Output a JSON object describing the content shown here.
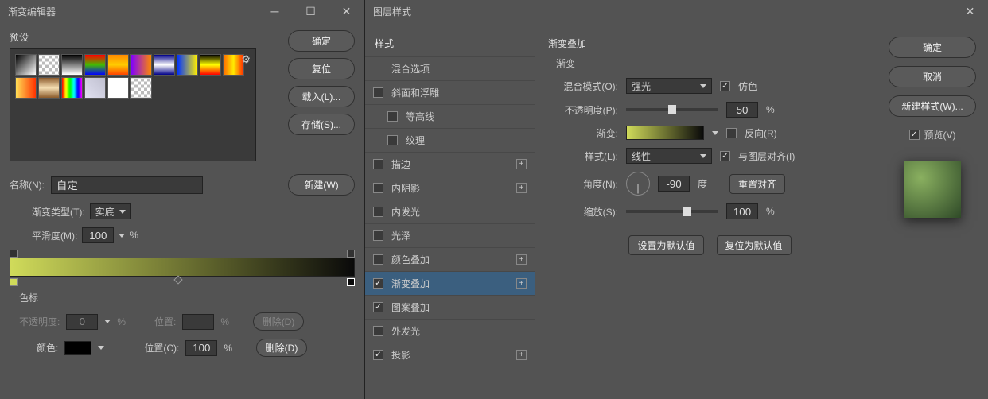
{
  "left": {
    "title": "渐变编辑器",
    "presets_label": "预设",
    "buttons": {
      "ok": "确定",
      "reset": "复位",
      "load": "载入(L)...",
      "save": "存储(S)...",
      "new": "新建(W)"
    },
    "name_label": "名称(N):",
    "name_value": "自定",
    "gradient_type_label": "渐变类型(T):",
    "gradient_type_value": "实底",
    "smoothness_label": "平滑度(M):",
    "smoothness_value": "100",
    "percent": "%",
    "color_stops_title": "色标",
    "opacity_label": "不透明度:",
    "opacity_value": "0",
    "position_label": "位置:",
    "position_c_label": "位置(C):",
    "position_value": "100",
    "delete_label": "删除(D)",
    "color_label": "颜色:"
  },
  "right": {
    "title": "图层样式",
    "styles_header": "样式",
    "styles": {
      "blending_options": "混合选项",
      "bevel_emboss": "斜面和浮雕",
      "contour": "等高线",
      "texture": "纹理",
      "stroke": "描边",
      "inner_shadow": "内阴影",
      "inner_glow": "内发光",
      "satin": "光泽",
      "color_overlay": "颜色叠加",
      "gradient_overlay": "渐变叠加",
      "pattern_overlay": "图案叠加",
      "outer_glow": "外发光",
      "drop_shadow": "投影"
    },
    "section_title": "渐变叠加",
    "sub_title": "渐变",
    "blend_mode_label": "混合模式(O):",
    "blend_mode_value": "强光",
    "dither_label": "仿色",
    "opacity_label": "不透明度(P):",
    "opacity_value": "50",
    "percent": "%",
    "gradient_label": "渐变:",
    "reverse_label": "反向(R)",
    "style_label": "样式(L):",
    "style_value": "线性",
    "align_label": "与图层对齐(I)",
    "angle_label": "角度(N):",
    "angle_value": "-90",
    "degree": "度",
    "reset_align": "重置对齐",
    "scale_label": "缩放(S):",
    "scale_value": "100",
    "set_default": "设置为默认值",
    "reset_default": "复位为默认值",
    "buttons": {
      "ok": "确定",
      "cancel": "取消",
      "new_style": "新建样式(W)...",
      "preview": "预览(V)"
    }
  }
}
